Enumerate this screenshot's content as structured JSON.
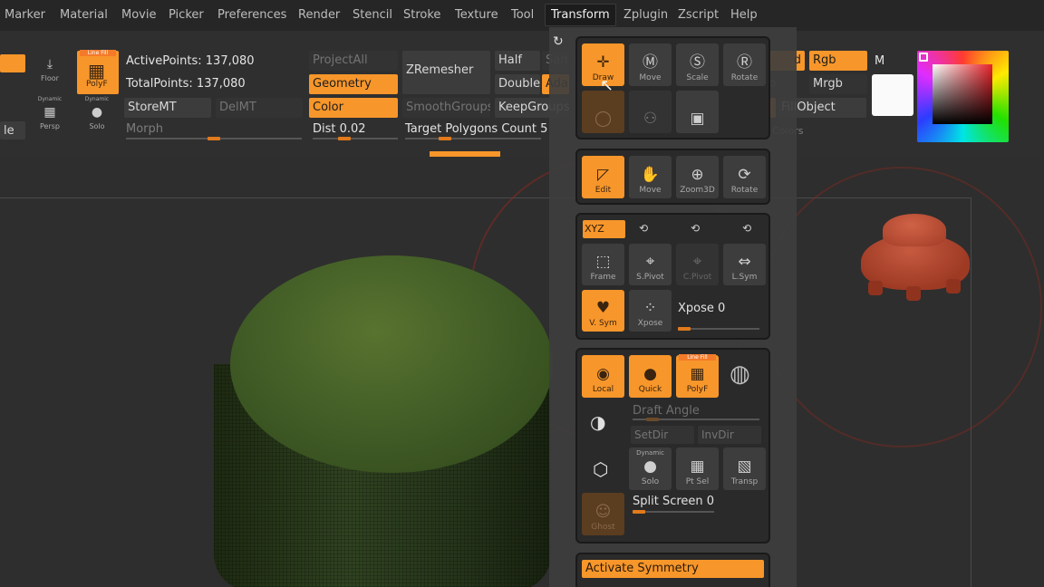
{
  "menu": [
    "Marker",
    "Material",
    "Movie",
    "Picker",
    "Preferences",
    "Render",
    "Stencil",
    "Stroke",
    "Texture",
    "Tool",
    "Transform",
    "Zplugin",
    "Zscript",
    "Help"
  ],
  "menu_active": "Transform",
  "toolbar": {
    "floor_label": "Floor",
    "polyf_label": "PolyF",
    "polyf_tag": "Line Fill",
    "persp_label": "Persp",
    "persp_tag": "Dynamic",
    "solo_label": "Solo",
    "solo_tag": "Dynamic",
    "partial_left": "le",
    "active_points": "ActivePoints: 137,080",
    "total_points": "TotalPoints: 137,080",
    "store_mt": "StoreMT",
    "del_mt": "DelMT",
    "morph": "Morph",
    "project_all": "ProjectAll",
    "geometry": "Geometry",
    "color": "Color",
    "dist": "Dist 0.02",
    "zremesher": "ZRemesher",
    "smooth_groups": "SmoothGroups",
    "target_polygons": "Target Polygons Count 5",
    "half": "Half",
    "same": "Same",
    "double": "Double",
    "adapt": "Adap",
    "keep_groups": "KeepGroups",
    "partial_rgb_left": "d",
    "partial_b": "b",
    "rgb": "Rgb",
    "m": "M",
    "mrgb": "Mrgb",
    "fill_object": "FillObject",
    "colors": "Colors",
    "accent_color": "#f7962a"
  },
  "transform_panel": {
    "undo_icon": "rotate-ccw-icon",
    "draw": "Draw",
    "move": "Move",
    "scale": "Scale",
    "rotate": "Rotate",
    "edit": "Edit",
    "move2": "Move",
    "zoom3d": "Zoom3D",
    "rotate2": "Rotate",
    "xyz": "XYZ",
    "frame": "Frame",
    "spivot": "S.Pivot",
    "cpivot": "C.Pivot",
    "lsym": "L.Sym",
    "vsym": "V. Sym",
    "xpose_btn": "Xpose",
    "xpose_slider": "Xpose 0",
    "local": "Local",
    "quick": "Quick",
    "polyf": "PolyF",
    "polyf_tag": "Line Fill",
    "draft_angle": "Draft Angle",
    "setdir": "SetDir",
    "invdir": "InvDir",
    "solo": "Solo",
    "solo_tag": "Dynamic",
    "ptsel": "Pt Sel",
    "transp": "Transp",
    "split_screen": "Split Screen 0",
    "ghost": "Ghost",
    "activate_symmetry": "Activate Symmetry"
  }
}
